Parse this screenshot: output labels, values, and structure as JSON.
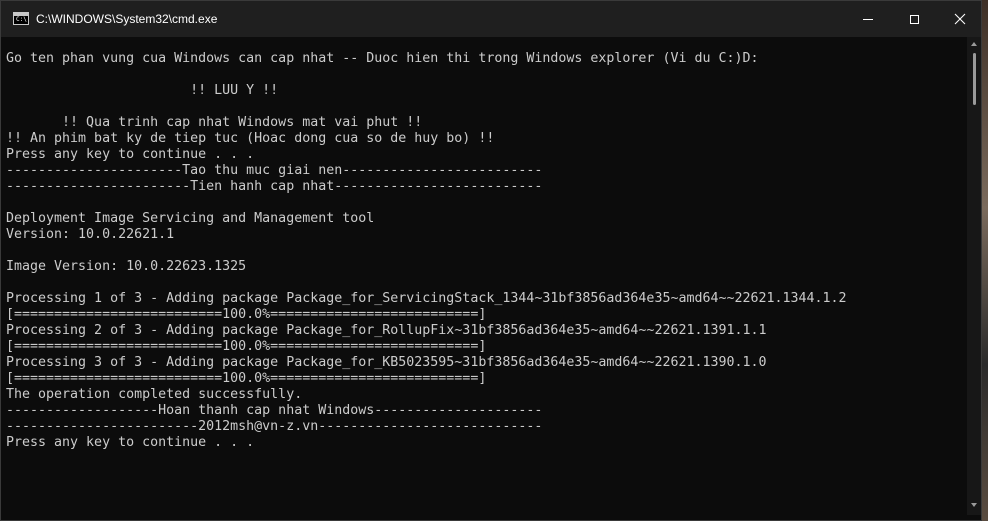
{
  "window": {
    "title": "C:\\WINDOWS\\System32\\cmd.exe",
    "icon": "cmd-icon",
    "icon_prompt": "C:\\"
  },
  "titlebar_buttons": {
    "minimize": "minimize-icon",
    "maximize": "maximize-icon",
    "close_glyph": "✕"
  },
  "console": {
    "text_color": "#cccccc",
    "background_color": "#0c0c0c",
    "lines": [
      "Go ten phan vung cua Windows can cap nhat -- Duoc hien thi trong Windows explorer (Vi du C:)D:",
      "",
      "                       !! LUU Y !!",
      "",
      "       !! Qua trinh cap nhat Windows mat vai phut !!",
      "!! An phim bat ky de tiep tuc (Hoac dong cua so de huy bo) !!",
      "Press any key to continue . . .",
      "----------------------Tao thu muc giai nen-------------------------",
      "-----------------------Tien hanh cap nhat--------------------------",
      "",
      "Deployment Image Servicing and Management tool",
      "Version: 10.0.22621.1",
      "",
      "Image Version: 10.0.22623.1325",
      "",
      "Processing 1 of 3 - Adding package Package_for_ServicingStack_1344~31bf3856ad364e35~amd64~~22621.1344.1.2",
      "[==========================100.0%==========================]",
      "Processing 2 of 3 - Adding package Package_for_RollupFix~31bf3856ad364e35~amd64~~22621.1391.1.1",
      "[==========================100.0%==========================]",
      "Processing 3 of 3 - Adding package Package_for_KB5023595~31bf3856ad364e35~amd64~~22621.1390.1.0",
      "[==========================100.0%==========================]",
      "The operation completed successfully.",
      "-------------------Hoan thanh cap nhat Windows---------------------",
      "------------------------2012msh@vn-z.vn----------------------------",
      "Press any key to continue . . ."
    ]
  }
}
